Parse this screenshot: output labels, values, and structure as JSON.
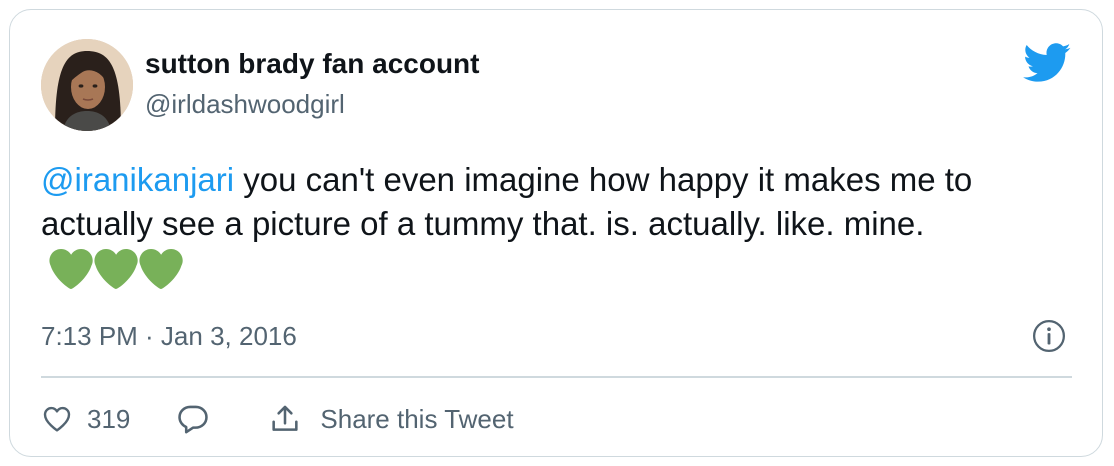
{
  "author": {
    "display_name": "sutton brady fan account",
    "handle": "@irldashwoodgirl"
  },
  "tweet": {
    "mention": "@iranikanjari",
    "text": " you can't even imagine how happy it makes me to actually see a picture of a tummy that. is. actually. like. mine.",
    "emoji": [
      "green-heart",
      "green-heart",
      "green-heart"
    ],
    "timestamp": "7:13 PM · Jan 3, 2016"
  },
  "actions": {
    "like_count": "319",
    "share_label": "Share this Tweet"
  },
  "icons": {
    "brand": "twitter-bird-icon",
    "info": "info-icon",
    "like": "heart-icon",
    "reply": "reply-bubble-icon",
    "share": "share-upload-icon"
  },
  "colors": {
    "accent": "#1d9bf0",
    "secondary_text": "#536471",
    "border": "#cfd9de",
    "heart_emoji": "#78b159"
  }
}
